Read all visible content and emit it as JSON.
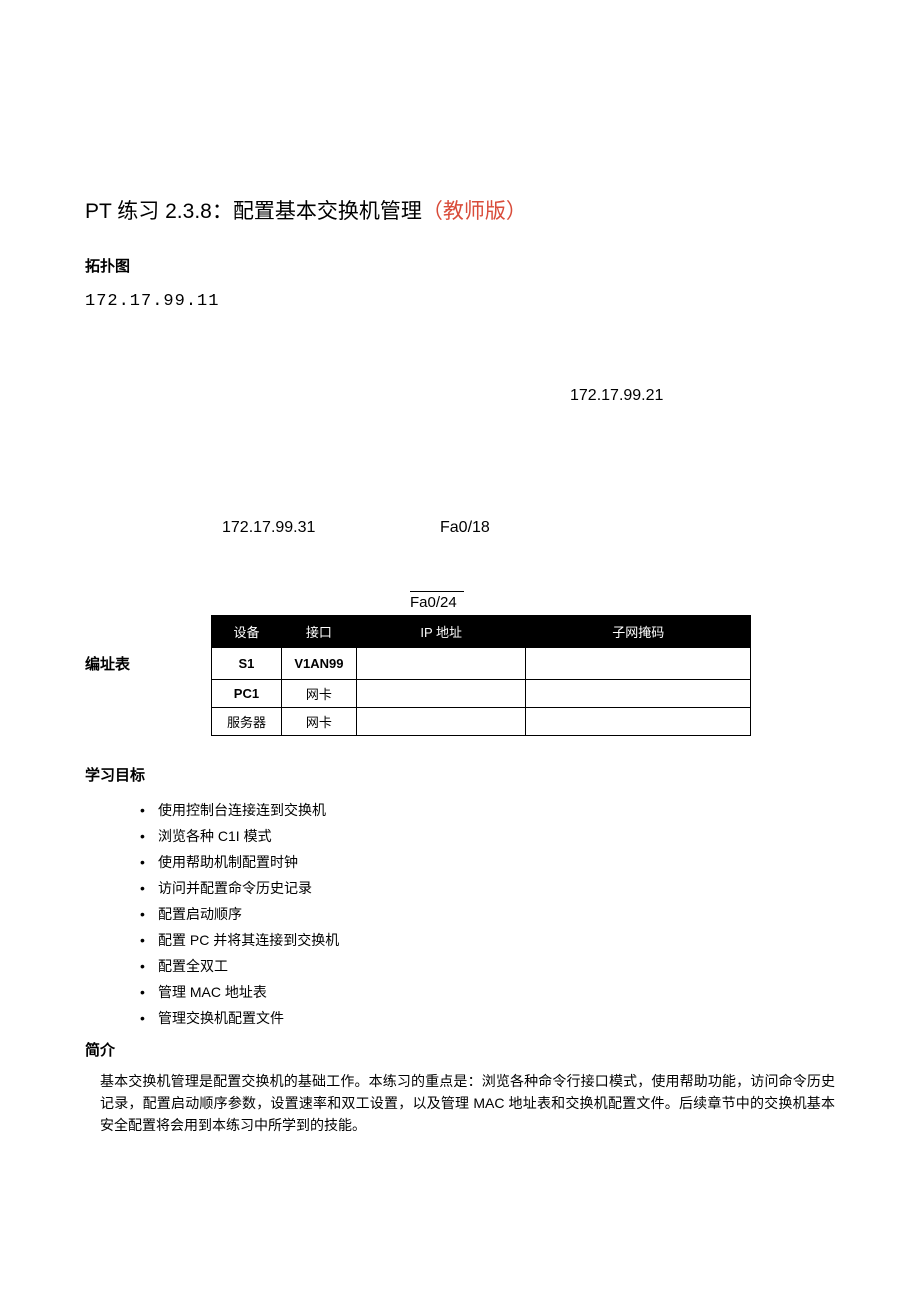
{
  "title": {
    "black": "PT 练习 2.3.8：配置基本交换机管理",
    "red": "（教师版）"
  },
  "topology": {
    "heading": "拓扑图",
    "ip_top": "172.17.99.11",
    "ip_right": "172.17.99.21",
    "ip_left2": "172.17.99.31",
    "fa18": "Fa0/18",
    "fa24": "Fa0/24"
  },
  "addr_table": {
    "label": "编址表",
    "headers": [
      "设备",
      "接口",
      "IP 地址",
      "子网掩码"
    ],
    "rows": [
      {
        "device": "S1",
        "iface": "V1AN99",
        "ip": "",
        "mask": ""
      },
      {
        "device": "PC1",
        "iface": "网卡",
        "ip": "",
        "mask": ""
      },
      {
        "device": "服务器",
        "iface": "网卡",
        "ip": "",
        "mask": ""
      }
    ]
  },
  "learning": {
    "heading": "学习目标",
    "items": [
      "使用控制台连接连到交换机",
      "浏览各种 C1I 模式",
      "使用帮助机制配置时钟",
      "访问并配置命令历史记录",
      "配置启动顺序",
      "配置 PC 并将其连接到交换机",
      "配置全双工",
      "管理 MAC 地址表",
      "管理交换机配置文件"
    ]
  },
  "intro": {
    "heading": "简介",
    "text": "基本交换机管理是配置交换机的基础工作。本练习的重点是：浏览各种命令行接口模式，使用帮助功能，访问命令历史记录，配置启动顺序参数，设置速率和双工设置，以及管理 MAC 地址表和交换机配置文件。后续章节中的交换机基本安全配置将会用到本练习中所学到的技能。"
  }
}
